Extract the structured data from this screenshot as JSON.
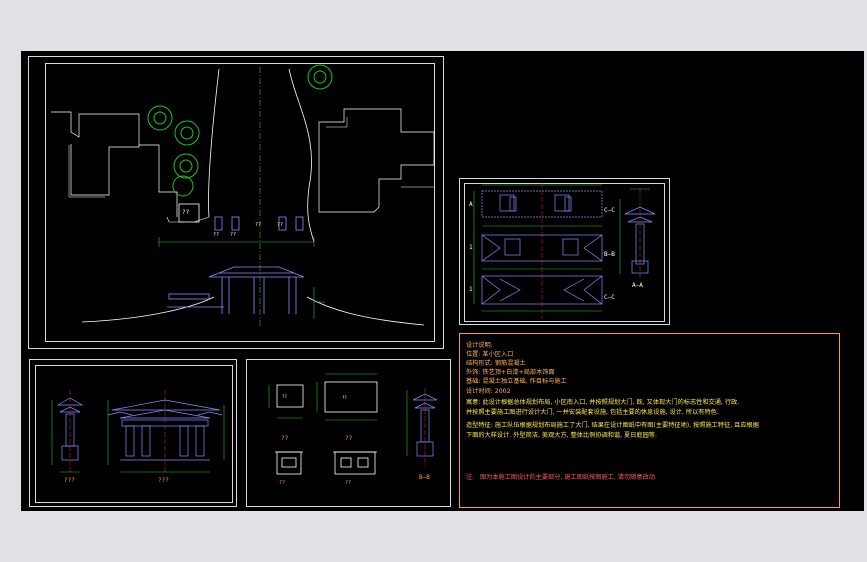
{
  "colors": {
    "background": "#000000",
    "frame": "#d8d8d8",
    "plan_lines": "#ffffff",
    "tree": "#1ec41e",
    "structure": "#8a8cff",
    "dimension": "#29c229",
    "axis": "#e03030",
    "note_border": "#ff9a3a",
    "note_text": "#ffb35a",
    "note_highlight": "#ffe94a",
    "note_label": "#ff5a5a"
  },
  "site_plan": {
    "booth_label": "??",
    "marker_labels": [
      "??",
      "??",
      "??",
      "??"
    ]
  },
  "elevations": {
    "column_caption": "???",
    "front_caption": "???",
    "section_caption": "B—B"
  },
  "booth_details": {
    "plan_label_1": "??",
    "plan_label_2": "??",
    "elev_label_1": "??",
    "elev_label_2": "??",
    "small_text_1": "??",
    "small_text_2": "??"
  },
  "sections": {
    "label_c": "C—C",
    "label_b": "B—B",
    "label_c2": "C—C",
    "label_a": "A—A",
    "side_marks": [
      "A",
      "1",
      "1"
    ]
  },
  "notes": {
    "title": "设计说明:",
    "location": "位置: 某小区入口",
    "structure": "结构形式: 钢筋混凝土",
    "finish": "外饰: 铁艺顶+白漆+局部木饰面",
    "foundation": "基础: 混凝土独立基础, 作目标与施工",
    "date": "设计时间: 2002",
    "concept_1": "寓意: 此设计根据总体规划布局, 小区南入口, 并按照规划大门, 既, 又体现大门的标志性和交通, 行政.",
    "concept_2": "    并按照主要施工图进行设计大门, 一并安装配套设施, 包括主要的休息设施, 设计, 所以有特色.",
    "features_1": "造型特征: 施工队伍根据规划布局施工了大门, 结果在设计图纸中有图(主要特征地), 按照施工特征, 且应根据",
    "features_2": "    下面的大样设计. 外型简洁, 美观大方, 整体比例协调和谐, 夏日庭园等.",
    "footer_label": "注:",
    "footer": "图为本施工图设计的主要部分, 施工图纸按图施工, 请勿随意改动."
  }
}
